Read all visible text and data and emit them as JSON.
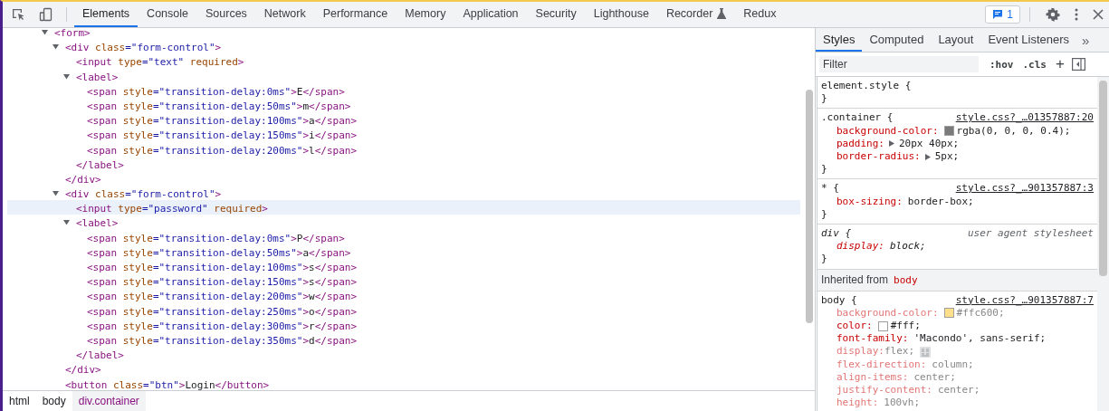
{
  "toolbar": {
    "tabs": [
      {
        "label": "Elements",
        "selected": true,
        "experimental": false
      },
      {
        "label": "Console",
        "selected": false,
        "experimental": false
      },
      {
        "label": "Sources",
        "selected": false,
        "experimental": false
      },
      {
        "label": "Network",
        "selected": false,
        "experimental": false
      },
      {
        "label": "Performance",
        "selected": false,
        "experimental": false
      },
      {
        "label": "Memory",
        "selected": false,
        "experimental": false
      },
      {
        "label": "Application",
        "selected": false,
        "experimental": false
      },
      {
        "label": "Security",
        "selected": false,
        "experimental": false
      },
      {
        "label": "Lighthouse",
        "selected": false,
        "experimental": false
      },
      {
        "label": "Recorder",
        "selected": false,
        "experimental": true
      },
      {
        "label": "Redux",
        "selected": false,
        "experimental": false
      }
    ],
    "issues_count": "1"
  },
  "elements": {
    "tree": [
      {
        "line": [
          {
            "kind": "tag",
            "text": "<form>"
          }
        ],
        "expanded": true,
        "selected": false,
        "children": [
          {
            "line": [
              {
                "kind": "tag",
                "text": "<div"
              },
              {
                "kind": "attr",
                "text": " class"
              },
              {
                "kind": "val",
                "text": "=\"form-control\""
              },
              {
                "kind": "tag",
                "text": ">"
              }
            ],
            "expanded": true,
            "selected": false,
            "end": [
              {
                "kind": "tag",
                "text": "</div>"
              }
            ],
            "children": [
              {
                "line": [
                  {
                    "kind": "tag",
                    "text": "<input"
                  },
                  {
                    "kind": "attr",
                    "text": " type"
                  },
                  {
                    "kind": "val",
                    "text": "=\"text\""
                  },
                  {
                    "kind": "attr",
                    "text": " required"
                  },
                  {
                    "kind": "tag",
                    "text": ">"
                  }
                ],
                "selected": false
              },
              {
                "line": [
                  {
                    "kind": "tag",
                    "text": "<label>"
                  }
                ],
                "expanded": true,
                "selected": false,
                "end": [
                  {
                    "kind": "tag",
                    "text": "</label>"
                  }
                ],
                "children": [
                  {
                    "line": [
                      {
                        "kind": "tag",
                        "text": "<span"
                      },
                      {
                        "kind": "attr",
                        "text": " style"
                      },
                      {
                        "kind": "val",
                        "text": "=\"transition-delay:0ms\""
                      },
                      {
                        "kind": "tag",
                        "text": ">"
                      },
                      {
                        "kind": "text",
                        "text": "E"
                      },
                      {
                        "kind": "tag",
                        "text": "</span>"
                      }
                    ],
                    "selected": false
                  },
                  {
                    "line": [
                      {
                        "kind": "tag",
                        "text": "<span"
                      },
                      {
                        "kind": "attr",
                        "text": " style"
                      },
                      {
                        "kind": "val",
                        "text": "=\"transition-delay:50ms\""
                      },
                      {
                        "kind": "tag",
                        "text": ">"
                      },
                      {
                        "kind": "text",
                        "text": "m"
                      },
                      {
                        "kind": "tag",
                        "text": "</span>"
                      }
                    ],
                    "selected": false
                  },
                  {
                    "line": [
                      {
                        "kind": "tag",
                        "text": "<span"
                      },
                      {
                        "kind": "attr",
                        "text": " style"
                      },
                      {
                        "kind": "val",
                        "text": "=\"transition-delay:100ms\""
                      },
                      {
                        "kind": "tag",
                        "text": ">"
                      },
                      {
                        "kind": "text",
                        "text": "a"
                      },
                      {
                        "kind": "tag",
                        "text": "</span>"
                      }
                    ],
                    "selected": false
                  },
                  {
                    "line": [
                      {
                        "kind": "tag",
                        "text": "<span"
                      },
                      {
                        "kind": "attr",
                        "text": " style"
                      },
                      {
                        "kind": "val",
                        "text": "=\"transition-delay:150ms\""
                      },
                      {
                        "kind": "tag",
                        "text": ">"
                      },
                      {
                        "kind": "text",
                        "text": "i"
                      },
                      {
                        "kind": "tag",
                        "text": "</span>"
                      }
                    ],
                    "selected": false
                  },
                  {
                    "line": [
                      {
                        "kind": "tag",
                        "text": "<span"
                      },
                      {
                        "kind": "attr",
                        "text": " style"
                      },
                      {
                        "kind": "val",
                        "text": "=\"transition-delay:200ms\""
                      },
                      {
                        "kind": "tag",
                        "text": ">"
                      },
                      {
                        "kind": "text",
                        "text": "l"
                      },
                      {
                        "kind": "tag",
                        "text": "</span>"
                      }
                    ],
                    "selected": false
                  }
                ]
              }
            ]
          },
          {
            "line": [
              {
                "kind": "tag",
                "text": "<div"
              },
              {
                "kind": "attr",
                "text": " class"
              },
              {
                "kind": "val",
                "text": "=\"form-control\""
              },
              {
                "kind": "tag",
                "text": ">"
              }
            ],
            "expanded": true,
            "selected": false,
            "end": [
              {
                "kind": "tag",
                "text": "</div>"
              }
            ],
            "children": [
              {
                "line": [
                  {
                    "kind": "tag",
                    "text": "<input"
                  },
                  {
                    "kind": "attr",
                    "text": " type"
                  },
                  {
                    "kind": "val",
                    "text": "=\"password\""
                  },
                  {
                    "kind": "attr",
                    "text": " required"
                  },
                  {
                    "kind": "tag",
                    "text": ">"
                  }
                ],
                "selected": true
              },
              {
                "line": [
                  {
                    "kind": "tag",
                    "text": "<label>"
                  }
                ],
                "expanded": true,
                "selected": false,
                "end": [
                  {
                    "kind": "tag",
                    "text": "</label>"
                  }
                ],
                "children": [
                  {
                    "line": [
                      {
                        "kind": "tag",
                        "text": "<span"
                      },
                      {
                        "kind": "attr",
                        "text": " style"
                      },
                      {
                        "kind": "val",
                        "text": "=\"transition-delay:0ms\""
                      },
                      {
                        "kind": "tag",
                        "text": ">"
                      },
                      {
                        "kind": "text",
                        "text": "P"
                      },
                      {
                        "kind": "tag",
                        "text": "</span>"
                      }
                    ],
                    "selected": false
                  },
                  {
                    "line": [
                      {
                        "kind": "tag",
                        "text": "<span"
                      },
                      {
                        "kind": "attr",
                        "text": " style"
                      },
                      {
                        "kind": "val",
                        "text": "=\"transition-delay:50ms\""
                      },
                      {
                        "kind": "tag",
                        "text": ">"
                      },
                      {
                        "kind": "text",
                        "text": "a"
                      },
                      {
                        "kind": "tag",
                        "text": "</span>"
                      }
                    ],
                    "selected": false
                  },
                  {
                    "line": [
                      {
                        "kind": "tag",
                        "text": "<span"
                      },
                      {
                        "kind": "attr",
                        "text": " style"
                      },
                      {
                        "kind": "val",
                        "text": "=\"transition-delay:100ms\""
                      },
                      {
                        "kind": "tag",
                        "text": ">"
                      },
                      {
                        "kind": "text",
                        "text": "s"
                      },
                      {
                        "kind": "tag",
                        "text": "</span>"
                      }
                    ],
                    "selected": false
                  },
                  {
                    "line": [
                      {
                        "kind": "tag",
                        "text": "<span"
                      },
                      {
                        "kind": "attr",
                        "text": " style"
                      },
                      {
                        "kind": "val",
                        "text": "=\"transition-delay:150ms\""
                      },
                      {
                        "kind": "tag",
                        "text": ">"
                      },
                      {
                        "kind": "text",
                        "text": "s"
                      },
                      {
                        "kind": "tag",
                        "text": "</span>"
                      }
                    ],
                    "selected": false
                  },
                  {
                    "line": [
                      {
                        "kind": "tag",
                        "text": "<span"
                      },
                      {
                        "kind": "attr",
                        "text": " style"
                      },
                      {
                        "kind": "val",
                        "text": "=\"transition-delay:200ms\""
                      },
                      {
                        "kind": "tag",
                        "text": ">"
                      },
                      {
                        "kind": "text",
                        "text": "w"
                      },
                      {
                        "kind": "tag",
                        "text": "</span>"
                      }
                    ],
                    "selected": false
                  },
                  {
                    "line": [
                      {
                        "kind": "tag",
                        "text": "<span"
                      },
                      {
                        "kind": "attr",
                        "text": " style"
                      },
                      {
                        "kind": "val",
                        "text": "=\"transition-delay:250ms\""
                      },
                      {
                        "kind": "tag",
                        "text": ">"
                      },
                      {
                        "kind": "text",
                        "text": "o"
                      },
                      {
                        "kind": "tag",
                        "text": "</span>"
                      }
                    ],
                    "selected": false
                  },
                  {
                    "line": [
                      {
                        "kind": "tag",
                        "text": "<span"
                      },
                      {
                        "kind": "attr",
                        "text": " style"
                      },
                      {
                        "kind": "val",
                        "text": "=\"transition-delay:300ms\""
                      },
                      {
                        "kind": "tag",
                        "text": ">"
                      },
                      {
                        "kind": "text",
                        "text": "r"
                      },
                      {
                        "kind": "tag",
                        "text": "</span>"
                      }
                    ],
                    "selected": false
                  },
                  {
                    "line": [
                      {
                        "kind": "tag",
                        "text": "<span"
                      },
                      {
                        "kind": "attr",
                        "text": " style"
                      },
                      {
                        "kind": "val",
                        "text": "=\"transition-delay:350ms\""
                      },
                      {
                        "kind": "tag",
                        "text": ">"
                      },
                      {
                        "kind": "text",
                        "text": "d"
                      },
                      {
                        "kind": "tag",
                        "text": "</span>"
                      }
                    ],
                    "selected": false
                  }
                ]
              }
            ]
          },
          {
            "line": [
              {
                "kind": "tag",
                "text": "<button"
              },
              {
                "kind": "attr",
                "text": " class"
              },
              {
                "kind": "val",
                "text": "=\"btn\""
              },
              {
                "kind": "tag",
                "text": ">"
              },
              {
                "kind": "text",
                "text": "Login"
              },
              {
                "kind": "tag",
                "text": "</button>"
              }
            ],
            "selected": false
          }
        ]
      }
    ],
    "breadcrumbs": [
      {
        "label": "html",
        "selected": false
      },
      {
        "label": "body",
        "selected": false
      },
      {
        "label": "div.container",
        "selected": true
      }
    ]
  },
  "styles": {
    "tabs": [
      {
        "label": "Styles",
        "selected": true
      },
      {
        "label": "Computed",
        "selected": false
      },
      {
        "label": "Layout",
        "selected": false
      },
      {
        "label": "Event Listeners",
        "selected": false
      }
    ],
    "more": "»",
    "filter": {
      "placeholder": "Filter"
    },
    "hov": ":hov",
    "cls": ".cls",
    "add": "+",
    "rules": [
      {
        "kind": "inline-rule",
        "selector": "element.style {",
        "close": "}"
      },
      {
        "kind": "file-rule",
        "selector": ".container {",
        "source": "style.css?_…01357887:20",
        "close": "}",
        "props": [
          {
            "kind": "swatch",
            "name": "background-color:",
            "value": "rgba(0, 0, 0, 0.4);",
            "color": "#7a7a7a",
            "dimmed": false
          },
          {
            "kind": "arrow",
            "name": "padding:",
            "value": "20px 40px;",
            "dimmed": false
          },
          {
            "kind": "arrow",
            "name": "border-radius:",
            "value": "5px;",
            "dimmed": false
          }
        ]
      },
      {
        "kind": "file-rule",
        "selector": "* {",
        "source": "style.css?_…901357887:3",
        "close": "}",
        "props": [
          {
            "kind": "plain",
            "name": "box-sizing:",
            "value": "border-box;",
            "dimmed": false
          }
        ]
      },
      {
        "kind": "agent-rule",
        "selector": "div {",
        "source": "user agent stylesheet",
        "close": "}",
        "props": [
          {
            "kind": "plain",
            "name": "display:",
            "value": "block;",
            "dimmed": false
          }
        ]
      },
      {
        "kind": "inherited",
        "label": "Inherited from",
        "target": "body"
      },
      {
        "kind": "file-rule",
        "selector": "body {",
        "source": "style.css?_…901357887:7",
        "props": [
          {
            "kind": "swatch",
            "name": "background-color:",
            "value": "#ffc600;",
            "color": "#ffe08a",
            "dimmed": true
          },
          {
            "kind": "swatch",
            "name": "color:",
            "value": "#fff;",
            "color": "#ffffff",
            "dimmed": false
          },
          {
            "kind": "plain",
            "name": "font-family:",
            "value": "'Macondo', sans-serif;",
            "dimmed": false
          },
          {
            "kind": "grid",
            "name": "display:",
            "value": "flex;",
            "dimmed": true
          },
          {
            "kind": "plain",
            "name": "flex-direction:",
            "value": "column;",
            "dimmed": true
          },
          {
            "kind": "plain",
            "name": "align-items:",
            "value": "center;",
            "dimmed": true
          },
          {
            "kind": "plain",
            "name": "justify-content:",
            "value": "center;",
            "dimmed": true
          },
          {
            "kind": "plain",
            "name": "height:",
            "value": "100vh;",
            "dimmed": true
          }
        ]
      }
    ]
  }
}
